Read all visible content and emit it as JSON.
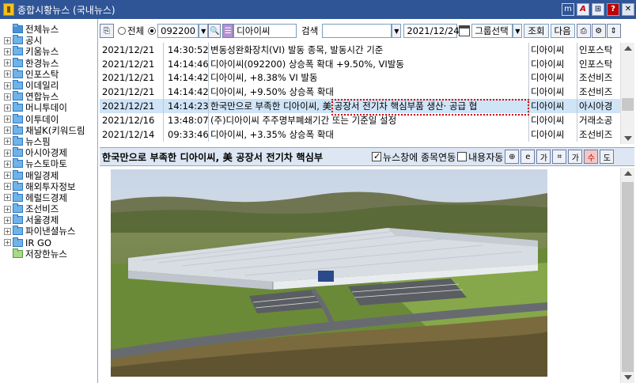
{
  "window": {
    "title": "종합시황뉴스 (국내뉴스)",
    "btn_m": "m",
    "btn_a": "A",
    "btn_help": "?",
    "btn_close": "✕"
  },
  "tree": {
    "items": [
      {
        "label": "전체뉴스",
        "expand": "",
        "folder": "open"
      },
      {
        "label": "공시",
        "expand": "+",
        "folder": "blue"
      },
      {
        "label": "키움뉴스",
        "expand": "+",
        "folder": "blue"
      },
      {
        "label": "한경뉴스",
        "expand": "+",
        "folder": "blue"
      },
      {
        "label": "인포스탁",
        "expand": "+",
        "folder": "blue"
      },
      {
        "label": "이데일리",
        "expand": "+",
        "folder": "blue"
      },
      {
        "label": "연합뉴스",
        "expand": "+",
        "folder": "blue"
      },
      {
        "label": "머니투데이",
        "expand": "+",
        "folder": "blue"
      },
      {
        "label": "이투데이",
        "expand": "+",
        "folder": "blue"
      },
      {
        "label": "채널K(키워드림",
        "expand": "+",
        "folder": "blue"
      },
      {
        "label": "뉴스핌",
        "expand": "+",
        "folder": "blue"
      },
      {
        "label": "아시아경제",
        "expand": "+",
        "folder": "blue"
      },
      {
        "label": "뉴스토마토",
        "expand": "+",
        "folder": "blue"
      },
      {
        "label": "매일경제",
        "expand": "+",
        "folder": "blue"
      },
      {
        "label": "해외투자정보",
        "expand": "+",
        "folder": "blue"
      },
      {
        "label": "헤럴드경제",
        "expand": "+",
        "folder": "blue"
      },
      {
        "label": "조선비즈",
        "expand": "+",
        "folder": "blue"
      },
      {
        "label": "서울경제",
        "expand": "+",
        "folder": "blue"
      },
      {
        "label": "파이낸셜뉴스",
        "expand": "+",
        "folder": "blue"
      },
      {
        "label": "IR GO",
        "expand": "+",
        "folder": "blue"
      },
      {
        "label": "저장한뉴스",
        "expand": "",
        "folder": "green"
      }
    ]
  },
  "toolbar": {
    "radio_all": "전체",
    "code": "092200",
    "stock_name": "디아이씨",
    "search_label": "검색",
    "search_value": "",
    "date": "2021/12/24",
    "group_select": "그룹선택",
    "inquiry": "조회",
    "next": "다음"
  },
  "news": {
    "rows": [
      {
        "date": "2021/12/21",
        "time": "14:30:52",
        "title": "변동성완화장치(VI) 발동 종목, 발동시간 기준",
        "org": "디아이씨",
        "src": "인포스탁",
        "selected": false
      },
      {
        "date": "2021/12/21",
        "time": "14:14:46",
        "title": "디아이씨(092200)  상승폭 확대 +9.50%, VI발동",
        "org": "디아이씨",
        "src": "인포스탁",
        "selected": false
      },
      {
        "date": "2021/12/21",
        "time": "14:14:42",
        "title": "디아이씨, +8.38% VI 발동",
        "org": "디아이씨",
        "src": "조선비즈",
        "selected": false
      },
      {
        "date": "2021/12/21",
        "time": "14:14:42",
        "title": "디아이씨, +9.50% 상승폭 확대",
        "org": "디아이씨",
        "src": "조선비즈",
        "selected": false
      },
      {
        "date": "2021/12/21",
        "time": "14:14:23",
        "title": "한국만으로 부족한 디아이씨, 美 공장서 전기차 핵심부품 생산· 공급 협",
        "org": "디아이씨",
        "src": "아시아경",
        "selected": true
      },
      {
        "date": "2021/12/16",
        "time": "13:48:07",
        "title": "(주)디아이씨 주주명부폐쇄기간 또는 기준일 설정",
        "org": "디아이씨",
        "src": "거래소공",
        "selected": false
      },
      {
        "date": "2021/12/14",
        "time": "09:33:46",
        "title": "디아이씨, +3.35% 상승폭 확대",
        "org": "디아이씨",
        "src": "조선비즈",
        "selected": false
      }
    ]
  },
  "article": {
    "title": "한국만으로 부족한 디아이씨, 美 공장서 전기차 핵심부",
    "news_link": "뉴스창에 종목연동",
    "auto_content": "내용자동"
  },
  "colors": {
    "titlebar": "#2f5597",
    "selected_row": "#cfe4f7",
    "highlight_box": "#d00000"
  }
}
